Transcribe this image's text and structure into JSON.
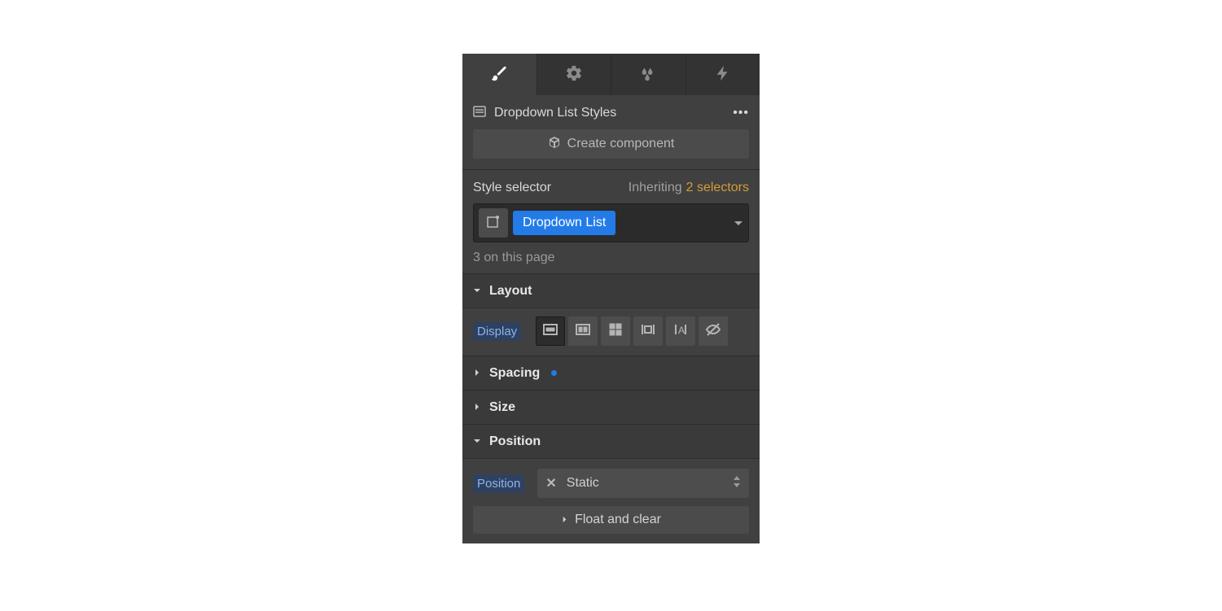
{
  "header": {
    "title": "Dropdown List Styles",
    "create_component": "Create component"
  },
  "style": {
    "label": "Style selector",
    "inheriting": "Inheriting",
    "selectors": "2 selectors",
    "tag": "Dropdown List",
    "page_count": "3 on this page"
  },
  "sections": {
    "layout": {
      "title": "Layout",
      "display_label": "Display"
    },
    "spacing": {
      "title": "Spacing"
    },
    "size": {
      "title": "Size"
    },
    "position": {
      "title": "Position",
      "position_label": "Position",
      "position_value": "Static",
      "float_clear": "Float and clear"
    }
  }
}
